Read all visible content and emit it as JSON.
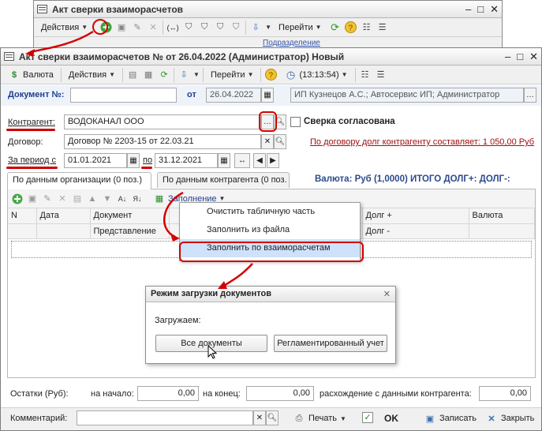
{
  "bg_window": {
    "title": "Акт сверки взаиморасчетов",
    "actions_label": "Действия",
    "goto_label": "Перейти",
    "col_fragment": "Подразделение"
  },
  "main_window": {
    "title": "Акт сверки взаиморасчетов №  от 26.04.2022 (Администратор) Новый",
    "toolbar": {
      "currency_label": "Валюта",
      "actions_label": "Действия",
      "goto_label": "Перейти",
      "time_label": "(13:13:54)"
    },
    "doc_label": "Документ №:",
    "doc_number": "",
    "from_label": "от",
    "doc_date": "26.04.2022",
    "org_value": "ИП Кузнецов А.С.; Автосервис ИП; Администратор",
    "contractor_label": "Контрагент:",
    "contractor_value": "ВОДОКАНАЛ ООО",
    "agreed_label": "Сверка согласована",
    "contract_label": "Договор:",
    "contract_value": "Договор № 2203-15  от 22.03.21",
    "debt_link": "По договору долг контрагенту составляет: 1 050,00 Руб",
    "period_label": "За период с",
    "period_from": "01.01.2021",
    "period_to_label": "по",
    "period_to": "31.12.2021",
    "tabs": [
      "По данным организации (0 поз.)",
      "По данным контрагента (0 поз."
    ],
    "totals_text": "Валюта: Руб (1,0000)  ИТОГО ДОЛГ+:   ДОЛГ-:",
    "fill_label": "Заполнение",
    "table": {
      "headers_top": [
        "N",
        "Дата",
        "Документ",
        "",
        "Долг +",
        "Валюта"
      ],
      "headers_sub": [
        "Представление",
        "Долг -"
      ]
    },
    "fill_menu": [
      "Очистить табличную часть",
      "Заполнить из файла",
      "Заполнить по взаиморасчетам"
    ],
    "balances": {
      "label": "Остатки (Руб):",
      "start_label": "на начало:",
      "start_value": "0,00",
      "end_label": "на конец:",
      "end_value": "0,00",
      "diff_label": "расхождение с данными контрагента:",
      "diff_value": "0,00"
    },
    "comment_label": "Комментарий:",
    "comment_value": "",
    "footer": {
      "print_label": "Печать",
      "ok_label": "OK",
      "save_label": "Записать",
      "close_label": "Закрыть"
    }
  },
  "dialog": {
    "title": "Режим загрузки документов",
    "message": "Загружаем:",
    "all_button": "Все документы",
    "regulated_button": "Регламентированный учет"
  },
  "colors": {
    "highlight_red": "#d40000",
    "label_blue": "#1f3f8f",
    "link_red": "#a01010",
    "total_blue": "#2b4a8c",
    "selected_menu": "#cfe2fb"
  }
}
